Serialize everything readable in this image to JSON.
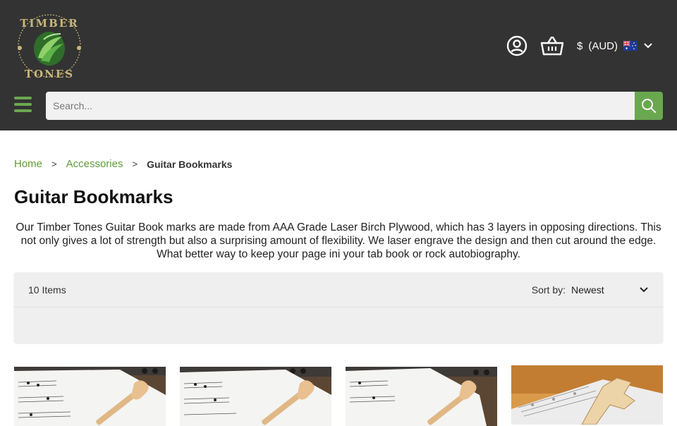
{
  "brand": {
    "logo_text": "TIMBER TONES"
  },
  "header": {
    "account_icon": "user-circle-icon",
    "cart_icon": "basket-icon",
    "currency": {
      "symbol": "$",
      "code": "(AUD)",
      "flag_icon": "australia-flag-icon"
    },
    "menu_icon": "hamburger-menu-icon"
  },
  "search": {
    "placeholder": "Search...",
    "value": "",
    "icon": "search-icon"
  },
  "breadcrumb": [
    {
      "label": "Home"
    },
    {
      "label": "Accessories"
    },
    {
      "label": "Guitar Bookmarks"
    }
  ],
  "page": {
    "title": "Guitar Bookmarks",
    "description": "Our Timber Tones Guitar Book marks are made from AAA Grade Laser Birch Plywood, which has 3 layers in opposing directions. This not only gives a lot of strength but also a surprising amount of flexibility. We laser engrave the design and then cut around the edge. What better way to keep your page ini your tab book or rock autobiography."
  },
  "toolbar": {
    "item_count": "10 Items",
    "sort_label": "Sort by:",
    "sort_value": "Newest"
  },
  "colors": {
    "header_bg": "#333333",
    "accent_green": "#6aa84f",
    "link_green": "#5f9a3b"
  },
  "products": [
    {
      "image": "guitar-bookmark-acoustic-photo"
    },
    {
      "image": "guitar-bookmark-acoustic-photo"
    },
    {
      "image": "guitar-bookmark-acoustic-photo"
    },
    {
      "image": "guitar-bookmark-electric-photo"
    }
  ]
}
